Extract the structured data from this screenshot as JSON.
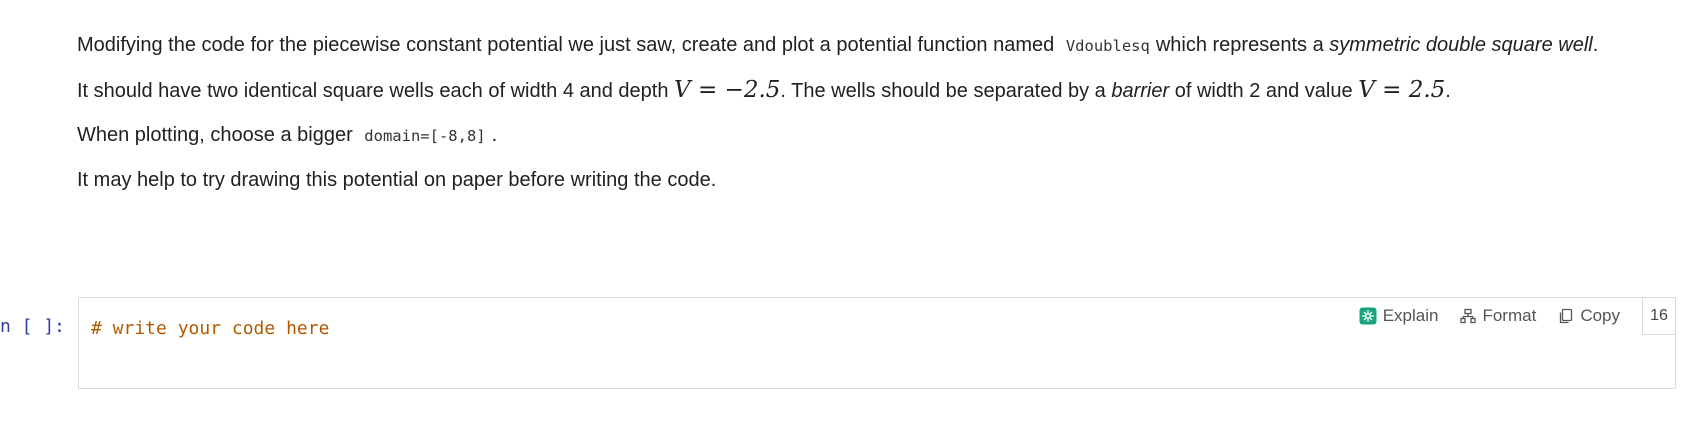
{
  "markdown": {
    "p1": {
      "text_a": "Modifying the code for the piecewise constant potential we just saw, create and plot a potential function named",
      "code": "Vdoublesq",
      "text_b": "which represents a",
      "emphasis": "symmetric double square well",
      "text_c": "."
    },
    "p2": {
      "text_a": "It should have two identical square wells each of width 4 and depth",
      "math_1": "V = −2.5",
      "text_b": ". The wells should be separated by a",
      "emphasis": "barrier",
      "text_c": "of width 2 and value",
      "math_2": "V = 2.5",
      "text_d": "."
    },
    "p3": {
      "text_a": "When plotting, choose a bigger",
      "code": "domain=[-8,8]",
      "text_b": "."
    },
    "p4": {
      "text": "It may help to try drawing this potential on paper before writing the code."
    }
  },
  "code_cell": {
    "prompt": "n [ ]:",
    "code": "# write your code here",
    "toolbar": {
      "explain_label": "Explain",
      "format_label": "Format",
      "copy_label": "Copy",
      "cell_number": "16"
    }
  }
}
